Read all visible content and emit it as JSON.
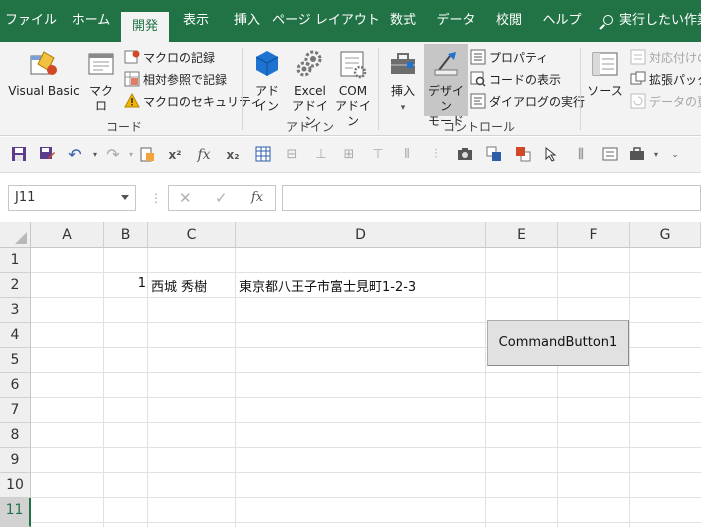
{
  "tabs": [
    {
      "label": "ファイル",
      "active": false
    },
    {
      "label": "ホーム",
      "active": false
    },
    {
      "label": "開発",
      "active": true
    },
    {
      "label": "表示",
      "active": false
    },
    {
      "label": "挿入",
      "active": false
    },
    {
      "label": "ページ レイアウト",
      "active": false
    },
    {
      "label": "数式",
      "active": false
    },
    {
      "label": "データ",
      "active": false
    },
    {
      "label": "校閲",
      "active": false
    },
    {
      "label": "ヘルプ",
      "active": false
    }
  ],
  "tell_me": "実行したい作業",
  "ribbon": {
    "code_group": {
      "label": "コード",
      "visual_basic": "Visual Basic",
      "macro": "マクロ",
      "record_macro": "マクロの記録",
      "relative_ref": "相対参照で記録",
      "macro_security": "マクロのセキュリティ"
    },
    "addin_group": {
      "label": "アドイン",
      "addin_line1": "アド",
      "addin_line2": "イン",
      "excel_addin_line1": "Excel",
      "excel_addin_line2": "アドイン",
      "com_addin_line1": "COM",
      "com_addin_line2": "アドイン"
    },
    "control_group": {
      "label": "コントロール",
      "insert": "挿入",
      "design_mode_line1": "デザイン",
      "design_mode_line2": "モード",
      "properties": "プロパティ",
      "view_code": "コードの表示",
      "run_dialog": "ダイアログの実行"
    },
    "xml_group": {
      "source": "ソース",
      "map_properties": "対応付けの",
      "expansion_packs": "拡張パック",
      "refresh_data": "データの更"
    }
  },
  "name_box": "J11",
  "formula_bar": {
    "cancel": "✕",
    "enter": "✓",
    "fx": "fx",
    "value": ""
  },
  "columns": [
    "A",
    "B",
    "C",
    "D",
    "E",
    "F",
    "G"
  ],
  "rows": [
    "1",
    "2",
    "3",
    "4",
    "5",
    "6",
    "7",
    "8",
    "9",
    "10",
    "11"
  ],
  "selected_row": "11",
  "cells": {
    "B2": "1",
    "C2": "西城 秀樹",
    "D2": "東京都八王子市富士見町1-2-3"
  },
  "command_button": "CommandButton1",
  "colors": {
    "accent": "#217346",
    "ribbon_bg": "#f3f3f3",
    "header_bg": "#efefef"
  }
}
